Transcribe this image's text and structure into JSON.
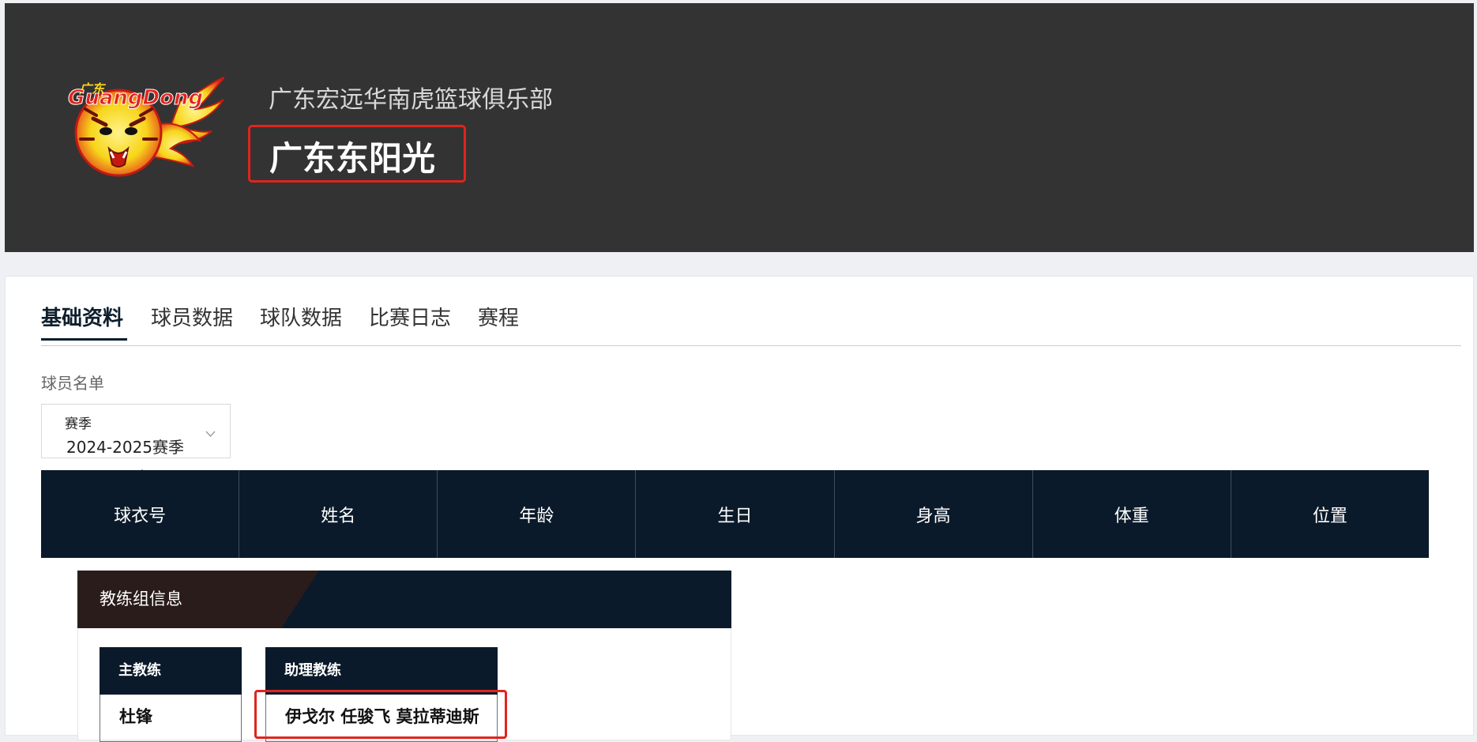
{
  "header": {
    "club_name": "广东宏远华南虎篮球俱乐部",
    "team_name": "广东东阳光",
    "logo": {
      "icon": "guangdong-tiger-logo",
      "small_text": "广东",
      "wordmark": "GuangDong"
    }
  },
  "tabs": [
    {
      "label": "基础资料",
      "active": true
    },
    {
      "label": "球员数据",
      "active": false
    },
    {
      "label": "球队数据",
      "active": false
    },
    {
      "label": "比赛日志",
      "active": false
    },
    {
      "label": "赛程",
      "active": false
    }
  ],
  "roster": {
    "section_label": "球员名单",
    "season_select": {
      "title": "赛季",
      "value": "2024-2025赛季",
      "icon": "chevron-down-icon"
    },
    "columns": [
      "球衣号",
      "姓名",
      "年龄",
      "生日",
      "身高",
      "体重",
      "位置"
    ]
  },
  "coaches": {
    "title": "教练组信息",
    "head_coach_label": "主教练",
    "head_coach_value": "杜锋",
    "assistant_label": "助理教练",
    "assistant_value": "伊戈尔 任骏飞 莫拉蒂迪斯"
  },
  "colors": {
    "header_bg": "#333333",
    "table_header_bg": "#0b1a2a",
    "highlight": "#e0241e",
    "logo_red": "#e0241e",
    "logo_yellow": "#f7d51a"
  }
}
